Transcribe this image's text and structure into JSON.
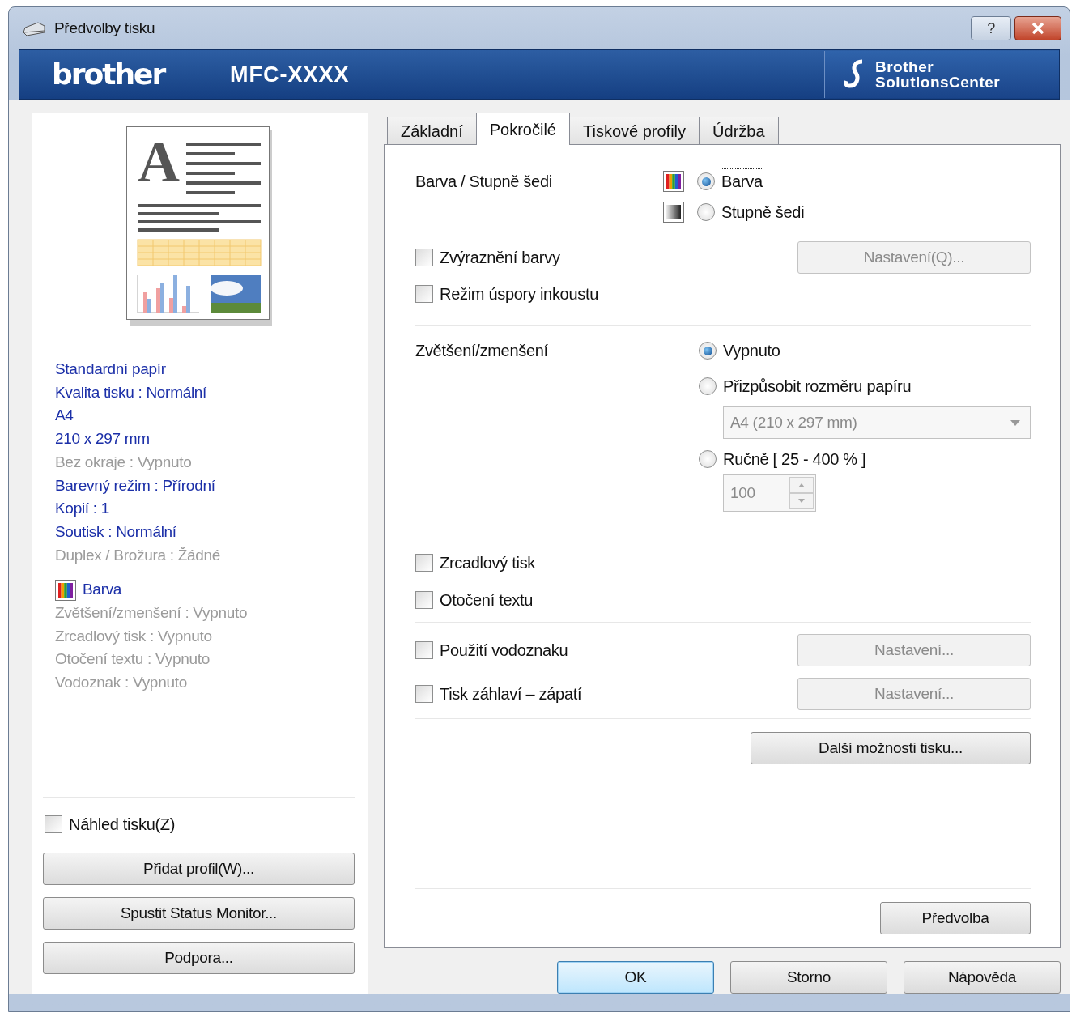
{
  "window": {
    "title": "Předvolby tisku",
    "help_button": "?"
  },
  "header": {
    "logo": "brother",
    "model": "MFC-XXXX",
    "solutions_center": [
      "Brother",
      "SolutionsCenter"
    ]
  },
  "preview_letter": "A",
  "summary": [
    {
      "text": "Standardní papír",
      "disabled": false
    },
    {
      "text": "Kvalita tisku : Normální",
      "disabled": false
    },
    {
      "text": "A4",
      "disabled": false
    },
    {
      "text": "210 x 297 mm",
      "disabled": false
    },
    {
      "text": "Bez okraje : Vypnuto",
      "disabled": true
    },
    {
      "text": "Barevný režim : Přírodní",
      "disabled": false
    },
    {
      "text": "Kopií : 1",
      "disabled": false
    },
    {
      "text": "Soutisk : Normální",
      "disabled": false
    },
    {
      "text": "Duplex / Brožura : Žádné",
      "disabled": true
    }
  ],
  "color_summary": {
    "text": "Barva",
    "disabled": false
  },
  "summary_more": [
    {
      "text": "Zvětšení/zmenšení : Vypnuto",
      "disabled": true
    },
    {
      "text": "Zrcadlový tisk : Vypnuto",
      "disabled": true
    },
    {
      "text": "Otočení textu : Vypnuto",
      "disabled": true
    },
    {
      "text": "Vodoznak : Vypnuto",
      "disabled": true
    }
  ],
  "preview_checkbox": {
    "label": "Náhled tisku(Z)",
    "checked": false
  },
  "left_buttons": [
    "Přidat profil(W)...",
    "Spustit Status Monitor...",
    "Podpora..."
  ],
  "tabs": [
    {
      "label": "Základní",
      "selected": false
    },
    {
      "label": "Pokročilé",
      "selected": true
    },
    {
      "label": "Tiskové profily",
      "selected": false
    },
    {
      "label": "Údržba",
      "selected": false
    }
  ],
  "color_section": {
    "label": "Barva / Stupně šedi",
    "options": [
      {
        "label": "Barva",
        "selected": true,
        "kind": "color"
      },
      {
        "label": "Stupně šedi",
        "selected": false,
        "kind": "gray"
      }
    ]
  },
  "checks_a": [
    {
      "label": "Zvýraznění barvy",
      "checked": false,
      "button": {
        "label": "Nastavení(Q)...",
        "disabled": true
      }
    },
    {
      "label": "Režim úspory inkoustu",
      "checked": false
    }
  ],
  "scaling": {
    "label": "Zvětšení/zmenšení",
    "options": [
      {
        "label": "Vypnuto",
        "selected": true
      },
      {
        "label": "Přizpůsobit rozměru papíru",
        "selected": false
      },
      {
        "label": "Ručně [ 25 - 400 % ]",
        "selected": false
      }
    ],
    "paper_select": {
      "value": "A4 (210 x 297 mm)",
      "disabled": true
    },
    "percent": {
      "value": "100",
      "disabled": true
    }
  },
  "checks_b": [
    {
      "label": "Zrcadlový tisk",
      "checked": false
    },
    {
      "label": "Otočení textu",
      "checked": false
    }
  ],
  "checks_c": [
    {
      "label": "Použití vodoznaku",
      "checked": false,
      "button": {
        "label": "Nastavení...",
        "disabled": true
      }
    },
    {
      "label": "Tisk záhlaví – zápatí",
      "checked": false,
      "button": {
        "label": "Nastavení...",
        "disabled": true
      }
    }
  ],
  "more_button": "Další možnosti tisku...",
  "default_button": "Předvolba",
  "footer_buttons": [
    {
      "label": "OK",
      "primary": true
    },
    {
      "label": "Storno",
      "primary": false
    },
    {
      "label": "Nápověda",
      "primary": false
    }
  ]
}
